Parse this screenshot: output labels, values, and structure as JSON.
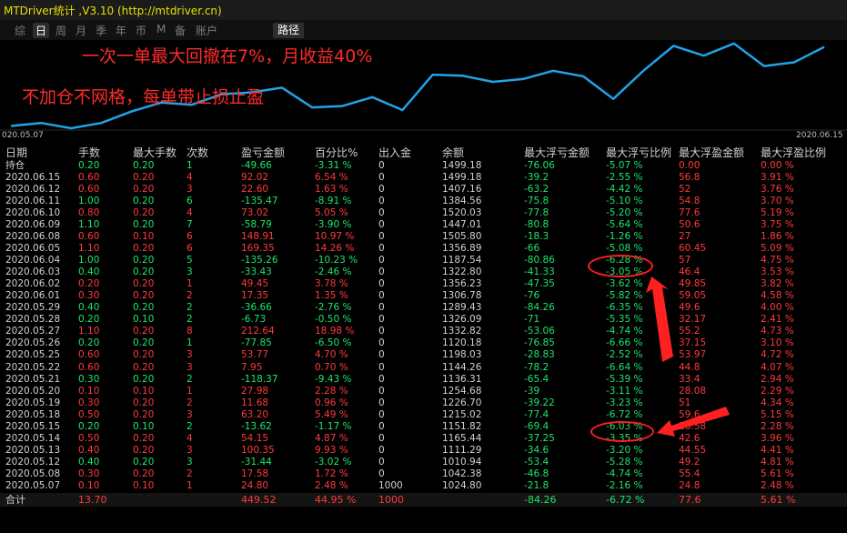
{
  "title": "MTDriver统计 ,V3.10 (http://mtdriver.cn)",
  "toolbar": {
    "tabs": [
      "综",
      "日",
      "周",
      "月",
      "季",
      "年",
      "币",
      "M",
      "备",
      "账户"
    ],
    "active": "日",
    "path_label": "路径"
  },
  "chart": {
    "start_label": "020.05.07",
    "end_label": "2020.06.15",
    "annotation1": "一次一单最大回撤在7%，月收益40%",
    "annotation2": "不加仓不网格，每单带止损止盈",
    "line_color": "#21a3e6",
    "series_values": [
      1024.8,
      1042.38,
      1010.94,
      1042.38,
      1111.29,
      1165.44,
      1151.82,
      1215.02,
      1226.7,
      1254.68,
      1136.31,
      1144.26,
      1198.03,
      1120.18,
      1332.82,
      1326.09,
      1289.43,
      1306.78,
      1356.23,
      1322.8,
      1187.54,
      1356.89,
      1505.8,
      1447.01,
      1520.03,
      1384.56,
      1407.16,
      1499.18
    ]
  },
  "colors": {
    "positive": "#1ee66a",
    "negative": "#ff3a3a",
    "neutral": "#d2d2d2",
    "annotation": "#ff2a2a"
  },
  "table": {
    "headers": [
      "日期",
      "手数",
      "最大手数",
      "次数",
      "盈亏金额",
      "百分比%",
      "出入金",
      "余额",
      "最大浮亏金额",
      "最大浮亏比例",
      "最大浮盈金额",
      "最大浮盈比例"
    ],
    "rows": [
      [
        "持仓",
        "0.20",
        "0.20",
        "1",
        "-49.66",
        "-3.31 %",
        "0",
        "1499.18",
        "-76.06",
        "-5.07 %",
        "0.00",
        "0.00 %"
      ],
      [
        "2020.06.15",
        "0.60",
        "0.20",
        "4",
        "92.02",
        "6.54 %",
        "0",
        "1499.18",
        "-39.2",
        "-2.55 %",
        "56.8",
        "3.91 %"
      ],
      [
        "2020.06.12",
        "0.60",
        "0.20",
        "3",
        "22.60",
        "1.63 %",
        "0",
        "1407.16",
        "-63.2",
        "-4.42 %",
        "52",
        "3.76 %"
      ],
      [
        "2020.06.11",
        "1.00",
        "0.20",
        "6",
        "-135.47",
        "-8.91 %",
        "0",
        "1384.56",
        "-75.8",
        "-5.10 %",
        "54.8",
        "3.70 %"
      ],
      [
        "2020.06.10",
        "0.80",
        "0.20",
        "4",
        "73.02",
        "5.05 %",
        "0",
        "1520.03",
        "-77.8",
        "-5.20 %",
        "77.6",
        "5.19 %"
      ],
      [
        "2020.06.09",
        "1.10",
        "0.20",
        "7",
        "-58.79",
        "-3.90 %",
        "0",
        "1447.01",
        "-80.8",
        "-5.64 %",
        "50.6",
        "3.75 %"
      ],
      [
        "2020.06.08",
        "0.60",
        "0.10",
        "6",
        "148.91",
        "10.97 %",
        "0",
        "1505.80",
        "-18.3",
        "-1.26 %",
        "27",
        "1.86 %"
      ],
      [
        "2020.06.05",
        "1.10",
        "0.20",
        "6",
        "169.35",
        "14.26 %",
        "0",
        "1356.89",
        "-66",
        "-5.08 %",
        "60.45",
        "5.09 %"
      ],
      [
        "2020.06.04",
        "1.00",
        "0.20",
        "5",
        "-135.26",
        "-10.23 %",
        "0",
        "1187.54",
        "-80.86",
        "-6.28 %",
        "57",
        "4.75 %"
      ],
      [
        "2020.06.03",
        "0.40",
        "0.20",
        "3",
        "-33.43",
        "-2.46 %",
        "0",
        "1322.80",
        "-41.33",
        "-3.05 %",
        "46.4",
        "3.53 %"
      ],
      [
        "2020.06.02",
        "0.20",
        "0.20",
        "1",
        "49.45",
        "3.78 %",
        "0",
        "1356.23",
        "-47.35",
        "-3.62 %",
        "49.85",
        "3.82 %"
      ],
      [
        "2020.06.01",
        "0.30",
        "0.20",
        "2",
        "17.35",
        "1.35 %",
        "0",
        "1306.78",
        "-76",
        "-5.82 %",
        "59.05",
        "4.58 %"
      ],
      [
        "2020.05.29",
        "0.40",
        "0.20",
        "2",
        "-36.66",
        "-2.76 %",
        "0",
        "1289.43",
        "-84.26",
        "-6.35 %",
        "49.6",
        "4.00 %"
      ],
      [
        "2020.05.28",
        "0.20",
        "0.10",
        "2",
        "-6.73",
        "-0.50 %",
        "0",
        "1326.09",
        "-71",
        "-5.35 %",
        "32.17",
        "2.41 %"
      ],
      [
        "2020.05.27",
        "1.10",
        "0.20",
        "8",
        "212.64",
        "18.98 %",
        "0",
        "1332.82",
        "-53.06",
        "-4.74 %",
        "55.2",
        "4.73 %"
      ],
      [
        "2020.05.26",
        "0.20",
        "0.20",
        "1",
        "-77.85",
        "-6.50 %",
        "0",
        "1120.18",
        "-76.85",
        "-6.66 %",
        "37.15",
        "3.10 %"
      ],
      [
        "2020.05.25",
        "0.60",
        "0.20",
        "3",
        "53.77",
        "4.70 %",
        "0",
        "1198.03",
        "-28.83",
        "-2.52 %",
        "53.97",
        "4.72 %"
      ],
      [
        "2020.05.22",
        "0.60",
        "0.20",
        "3",
        "7.95",
        "0.70 %",
        "0",
        "1144.26",
        "-78.2",
        "-6.64 %",
        "44.8",
        "4.07 %"
      ],
      [
        "2020.05.21",
        "0.30",
        "0.20",
        "2",
        "-118.37",
        "-9.43 %",
        "0",
        "1136.31",
        "-65.4",
        "-5.39 %",
        "33.4",
        "2.94 %"
      ],
      [
        "2020.05.20",
        "0.10",
        "0.10",
        "1",
        "27.98",
        "2.28 %",
        "0",
        "1254.68",
        "-39",
        "-3.11 %",
        "28.08",
        "2.29 %"
      ],
      [
        "2020.05.19",
        "0.30",
        "0.20",
        "2",
        "11.68",
        "0.96 %",
        "0",
        "1226.70",
        "-39.22",
        "-3.23 %",
        "51",
        "4.34 %"
      ],
      [
        "2020.05.18",
        "0.50",
        "0.20",
        "3",
        "63.20",
        "5.49 %",
        "0",
        "1215.02",
        "-77.4",
        "-6.72 %",
        "59.6",
        "5.15 %"
      ],
      [
        "2020.05.15",
        "0.20",
        "0.10",
        "2",
        "-13.62",
        "-1.17 %",
        "0",
        "1151.82",
        "-69.4",
        "-6.03 %",
        "26.58",
        "2.28 %"
      ],
      [
        "2020.05.14",
        "0.50",
        "0.20",
        "4",
        "54.15",
        "4.87 %",
        "0",
        "1165.44",
        "-37.25",
        "-3.35 %",
        "42.6",
        "3.96 %"
      ],
      [
        "2020.05.13",
        "0.40",
        "0.20",
        "3",
        "100.35",
        "9.93 %",
        "0",
        "1111.29",
        "-34.6",
        "-3.20 %",
        "44.55",
        "4.41 %"
      ],
      [
        "2020.05.12",
        "0.40",
        "0.20",
        "3",
        "-31.44",
        "-3.02 %",
        "0",
        "1010.94",
        "-53.4",
        "-5.28 %",
        "49.2",
        "4.81 %"
      ],
      [
        "2020.05.08",
        "0.30",
        "0.20",
        "2",
        "17.58",
        "1.72 %",
        "0",
        "1042.38",
        "-46.8",
        "-4.74 %",
        "55.4",
        "5.61 %"
      ],
      [
        "2020.05.07",
        "0.10",
        "0.10",
        "1",
        "24.80",
        "2.48 %",
        "1000",
        "1024.80",
        "-21.8",
        "-2.16 %",
        "24.8",
        "2.48 %"
      ]
    ],
    "total": [
      "合计",
      "13.70",
      "",
      "",
      "449.52",
      "44.95 %",
      "1000",
      "",
      "-84.26",
      "-6.72 %",
      "77.6",
      "5.61 %"
    ]
  }
}
